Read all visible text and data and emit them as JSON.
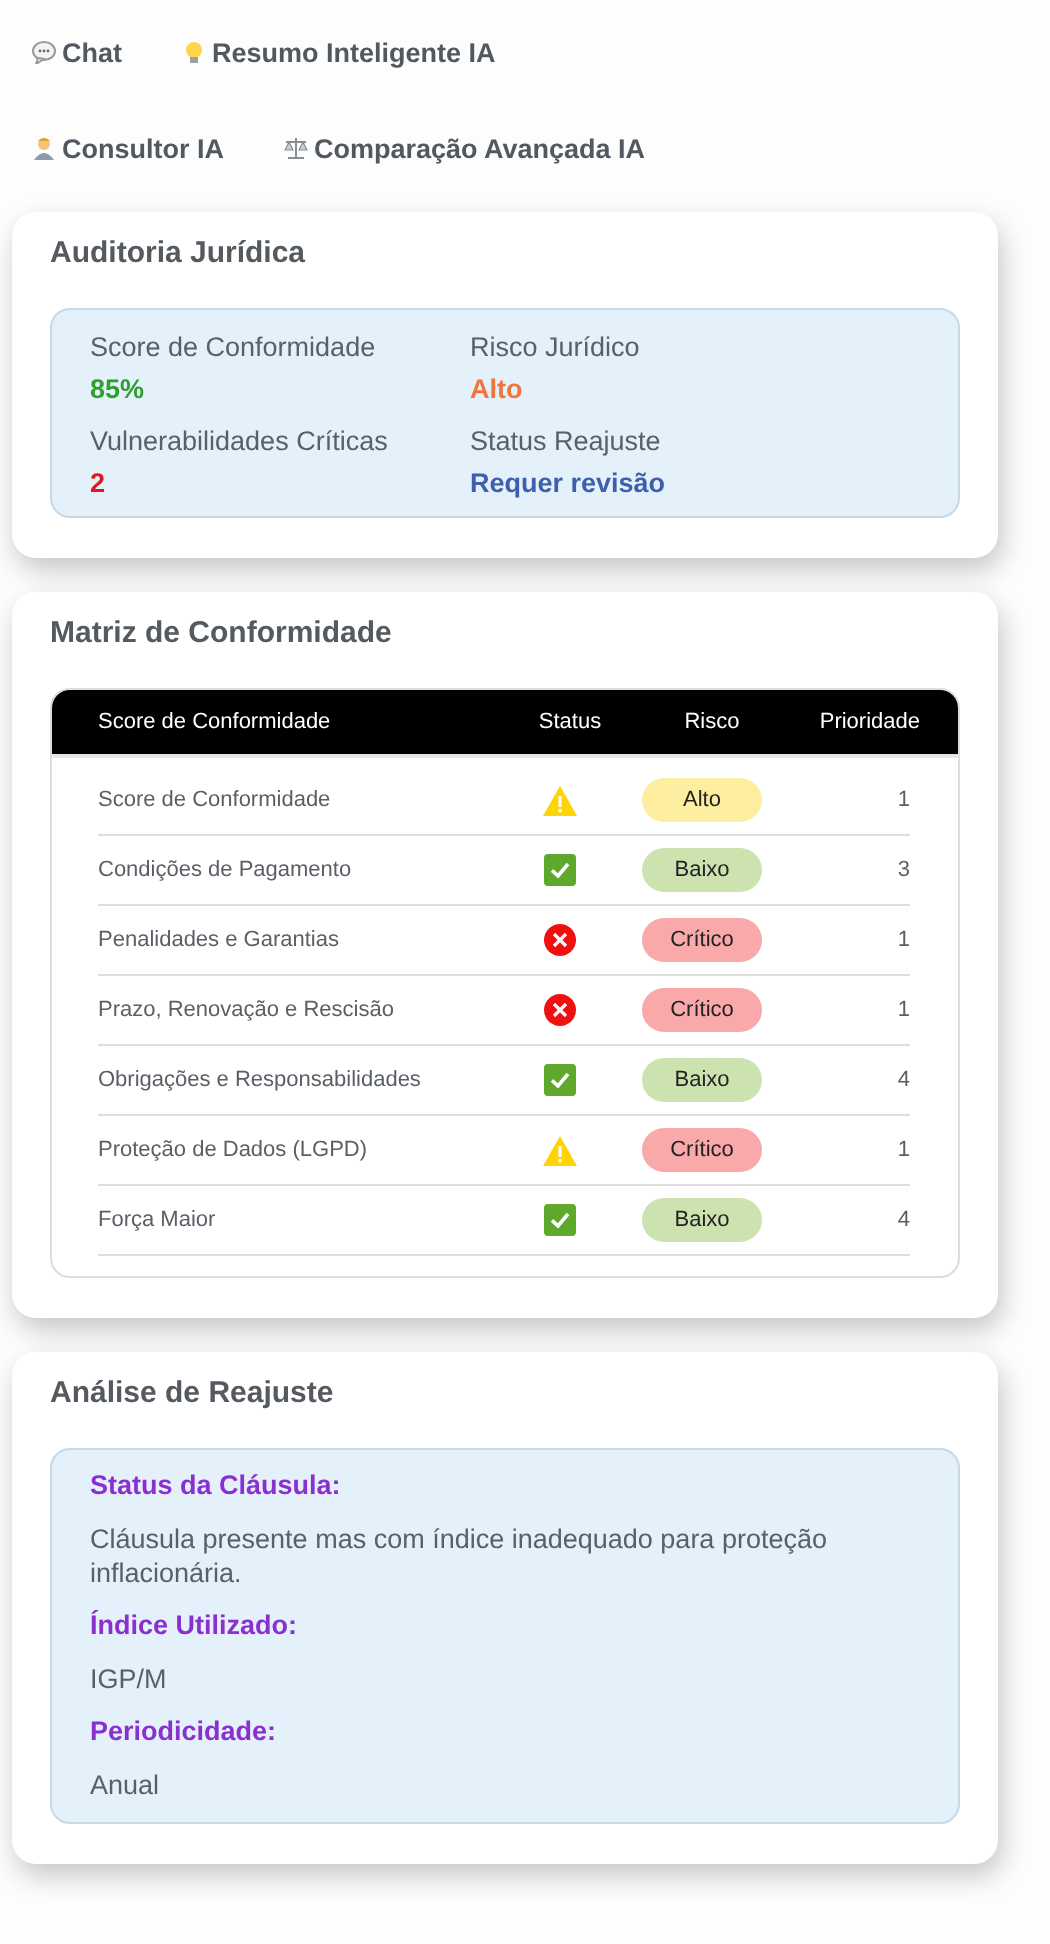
{
  "nav": [
    {
      "label": "Chat",
      "kind": "chat"
    },
    {
      "label": "Resumo Inteligente IA",
      "kind": "idea"
    },
    {
      "label": "Consultor IA",
      "kind": "person"
    },
    {
      "label": "Comparação Avançada IA",
      "kind": "scales"
    }
  ],
  "audit": {
    "title": "Auditoria Jurídica",
    "metrics": [
      {
        "label": "Score de Conformidade",
        "value": "85%",
        "color": "#2ea02e"
      },
      {
        "label": "Risco Jurídico",
        "value": "Alto",
        "color": "#f2743a"
      },
      {
        "label": "Vulnerabilidades Críticas",
        "value": "2",
        "color": "#e8141b"
      },
      {
        "label": "Status Reajuste",
        "value": "Requer revisão",
        "color": "#3e5fad"
      }
    ]
  },
  "matrix": {
    "title": "Matriz de Conformidade",
    "columns": [
      "Score de Conformidade",
      "Status",
      "Risco",
      "Prioridade"
    ],
    "rows": [
      {
        "item": "Score de Conformidade",
        "status": {
          "kind": "warning"
        },
        "risk": {
          "label": "Alto",
          "kind": "high"
        },
        "priority": "1"
      },
      {
        "item": "Condições de Pagamento",
        "status": {
          "kind": "ok"
        },
        "risk": {
          "label": "Baixo",
          "kind": "low"
        },
        "priority": "3"
      },
      {
        "item": "Penalidades e Garantias",
        "status": {
          "kind": "error"
        },
        "risk": {
          "label": "Crítico",
          "kind": "critical"
        },
        "priority": "1"
      },
      {
        "item": "Prazo, Renovação e Rescisão",
        "status": {
          "kind": "error"
        },
        "risk": {
          "label": "Crítico",
          "kind": "critical"
        },
        "priority": "1"
      },
      {
        "item": "Obrigações e Responsabilidades",
        "status": {
          "kind": "ok"
        },
        "risk": {
          "label": "Baixo",
          "kind": "low"
        },
        "priority": "4"
      },
      {
        "item": "Proteção de Dados (LGPD)",
        "status": {
          "kind": "warning"
        },
        "risk": {
          "label": "Crítico",
          "kind": "critical"
        },
        "priority": "1"
      },
      {
        "item": "Força Maior",
        "status": {
          "kind": "ok"
        },
        "risk": {
          "label": "Baixo",
          "kind": "low"
        },
        "priority": "4"
      }
    ]
  },
  "adjustment": {
    "title": "Análise de Reajuste",
    "sections": [
      {
        "heading": "Status da Cláusula:",
        "text": "Cláusula presente mas com índice inadequado para proteção inflacionária."
      },
      {
        "heading": "Índice Utilizado:",
        "text": "IGP/M"
      },
      {
        "heading": "Periodicidade:",
        "text": "Anual"
      }
    ]
  }
}
